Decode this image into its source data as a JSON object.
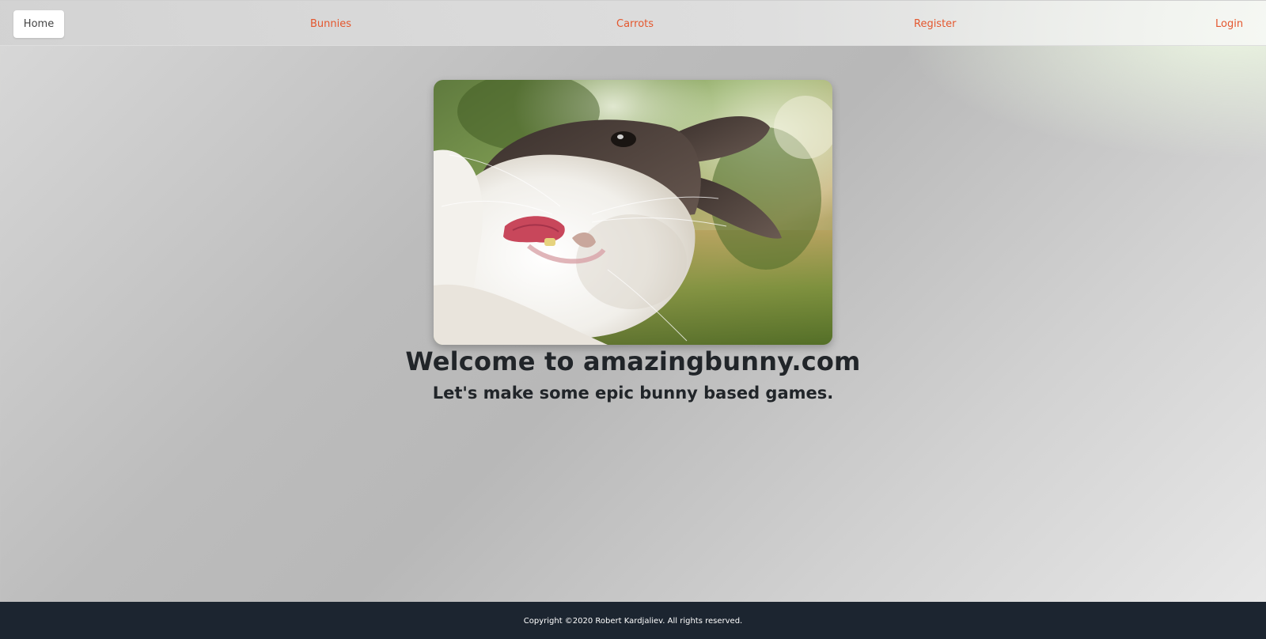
{
  "nav": {
    "home_label": "Home",
    "items": [
      {
        "label": "Bunnies"
      },
      {
        "label": "Carrots"
      },
      {
        "label": "Register"
      },
      {
        "label": "Login"
      }
    ],
    "link_color": "#e4572e"
  },
  "hero": {
    "image_icon": "bunny-photo",
    "title": "Welcome to amazingbunny.com",
    "subtitle": "Let's make some epic bunny based games."
  },
  "footer": {
    "copyright": "Copyright ©2020 Robert Kardjaliev. All rights reserved.",
    "background": "#1c2530"
  }
}
